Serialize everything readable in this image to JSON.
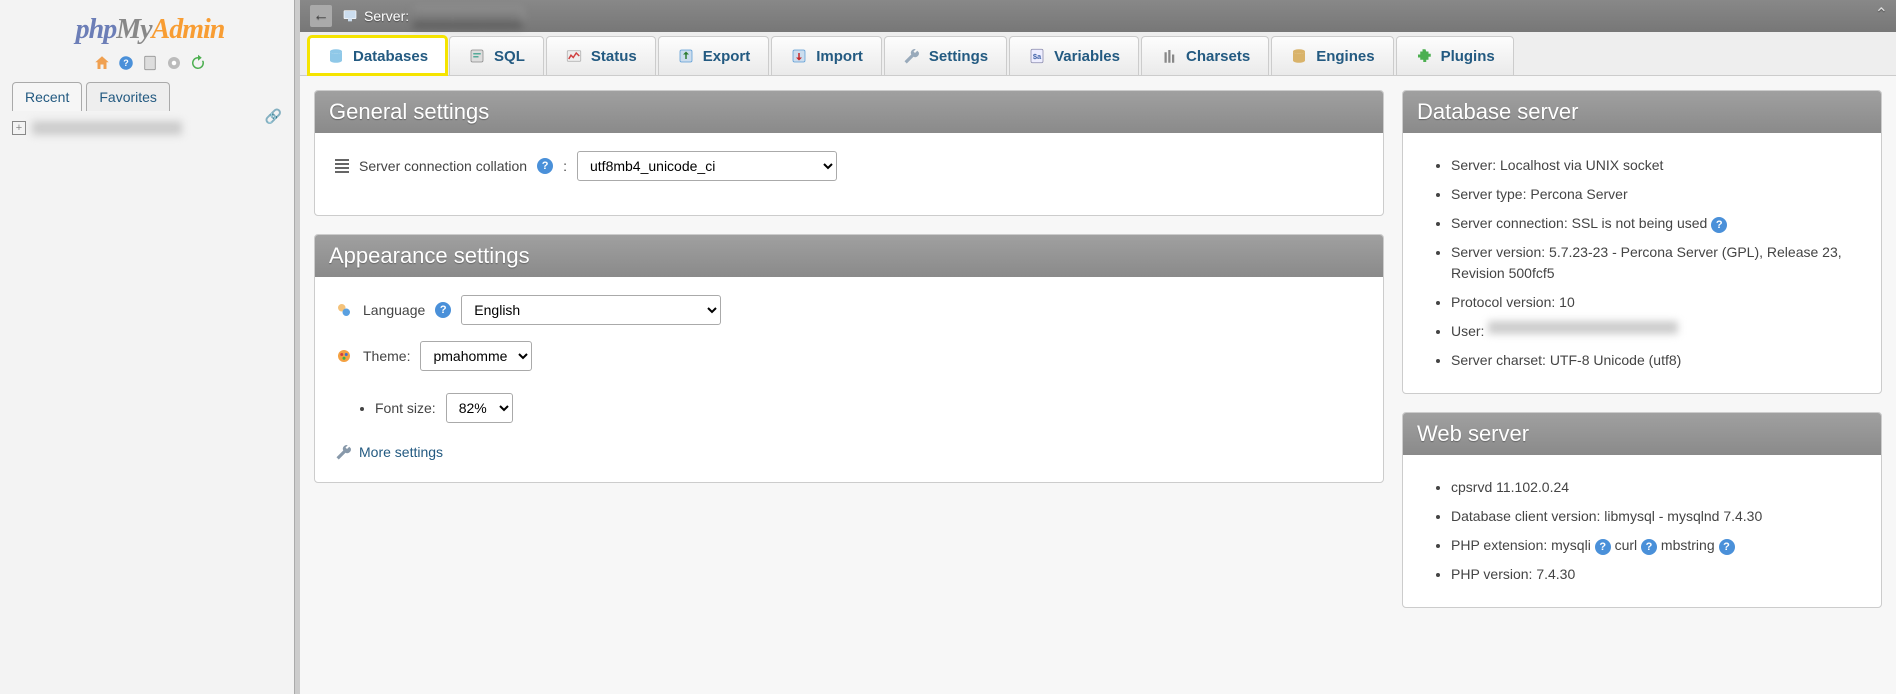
{
  "logo": {
    "p1": "php",
    "p2": "My",
    "p3": "Admin"
  },
  "sidebar": {
    "tabs": {
      "recent": "Recent",
      "favorites": "Favorites"
    },
    "tree_item_blur": "████████████"
  },
  "topbar": {
    "server_label": "Server:",
    "server_value_blur": "███████████"
  },
  "tabs": [
    {
      "label": "Databases",
      "name": "tab-databases",
      "active": true
    },
    {
      "label": "SQL",
      "name": "tab-sql"
    },
    {
      "label": "Status",
      "name": "tab-status"
    },
    {
      "label": "Export",
      "name": "tab-export"
    },
    {
      "label": "Import",
      "name": "tab-import"
    },
    {
      "label": "Settings",
      "name": "tab-settings"
    },
    {
      "label": "Variables",
      "name": "tab-variables"
    },
    {
      "label": "Charsets",
      "name": "tab-charsets"
    },
    {
      "label": "Engines",
      "name": "tab-engines"
    },
    {
      "label": "Plugins",
      "name": "tab-plugins"
    }
  ],
  "general": {
    "title": "General settings",
    "collation_label": "Server connection collation",
    "collation_value": "utf8mb4_unicode_ci"
  },
  "appearance": {
    "title": "Appearance settings",
    "language_label": "Language",
    "language_value": "English",
    "theme_label": "Theme:",
    "theme_value": "pmahomme",
    "fontsize_label": "Font size:",
    "fontsize_value": "82%",
    "more": "More settings"
  },
  "dbserver": {
    "title": "Database server",
    "items": [
      "Server: Localhost via UNIX socket",
      "Server type: Percona Server",
      "Server connection: SSL is not being used",
      "Server version: 5.7.23-23 - Percona Server (GPL), Release 23, Revision 500fcf5",
      "Protocol version: 10",
      "User:",
      "Server charset: UTF-8 Unicode (utf8)"
    ],
    "user_blur": "███████████████"
  },
  "webserver": {
    "title": "Web server",
    "items": [
      "cpsrvd 11.102.0.24",
      "Database client version: libmysql - mysqlnd 7.4.30",
      "PHP extension: mysqli  curl  mbstring",
      "PHP version: 7.4.30"
    ]
  }
}
